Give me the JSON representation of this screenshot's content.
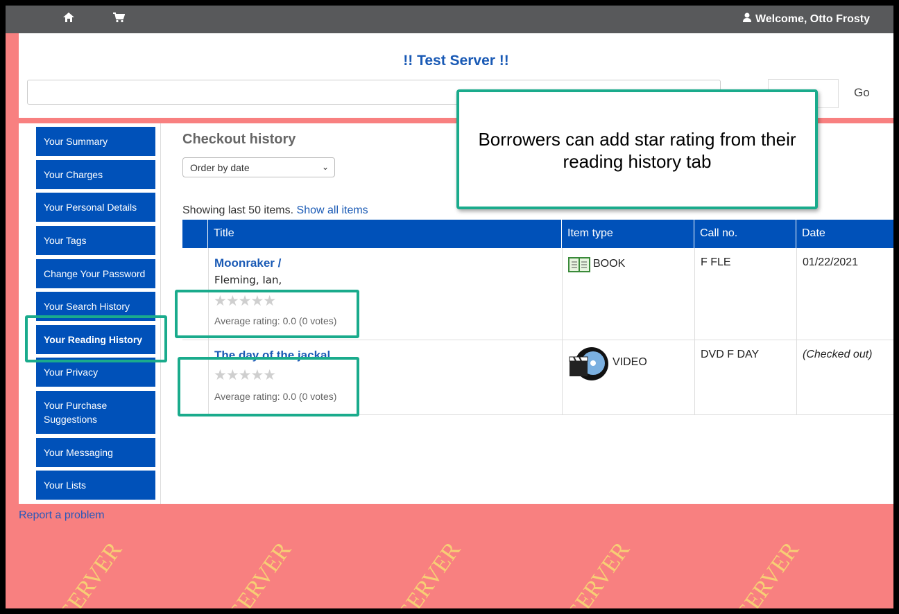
{
  "topbar": {
    "home_icon": "home-icon",
    "cart_icon": "cart-icon",
    "welcome": "Welcome, Otto Frosty"
  },
  "header": {
    "site_title": "!! Test Server !!",
    "search_placeholder": "",
    "go_label": "Go"
  },
  "watermark": "TEST SERVER",
  "sidebar": {
    "items": [
      {
        "label": "Your Summary"
      },
      {
        "label": "Your Charges"
      },
      {
        "label": "Your Personal Details"
      },
      {
        "label": "Your Tags"
      },
      {
        "label": "Change Your Password"
      },
      {
        "label": "Your Search History"
      },
      {
        "label": "Your Reading History",
        "active": true
      },
      {
        "label": "Your Privacy"
      },
      {
        "label": "Your Purchase Suggestions"
      },
      {
        "label": "Your Messaging"
      },
      {
        "label": "Your Lists"
      }
    ]
  },
  "content": {
    "heading": "Checkout history",
    "sort_selected": "Order by date",
    "showing": "Showing last 50 items.",
    "show_all": "Show all items",
    "columns": [
      "Title",
      "Item type",
      "Call no.",
      "Date"
    ],
    "rows": [
      {
        "title": "Moonraker /",
        "author": "Fleming, Ian,",
        "rating": 0,
        "avg_rating": "Average rating: 0.0 (0 votes)",
        "item_type": "BOOK",
        "item_icon": "book-icon",
        "call_no": "F FLE",
        "date": "01/22/2021"
      },
      {
        "title": "The day of the jackal",
        "author": "",
        "rating": 0,
        "avg_rating": "Average rating: 0.0 (0 votes)",
        "item_type": "VIDEO",
        "item_icon": "video-icon",
        "call_no": "DVD F DAY",
        "date": "(Checked out)"
      }
    ]
  },
  "callout_text": "Borrowers can add star rating from their reading history tab",
  "footer": {
    "report": "Report a problem"
  },
  "colors": {
    "accent": "#0051b9",
    "callout": "#1aab8c",
    "background": "#f88080",
    "topbar": "#58595b"
  }
}
